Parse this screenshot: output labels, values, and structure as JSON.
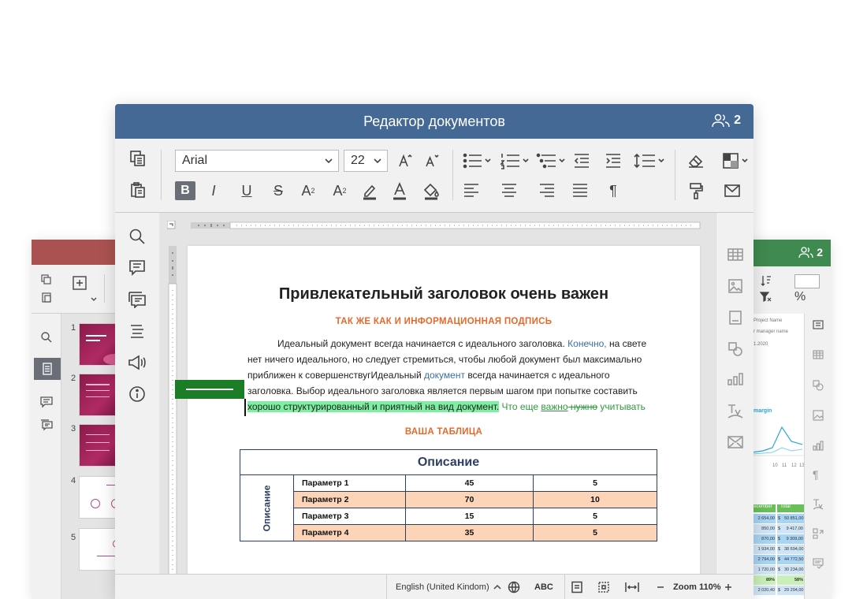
{
  "main_window": {
    "title": "Редактор документов",
    "users_count": "2",
    "toolbar": {
      "font_name": "Arial",
      "font_size": "22",
      "bold_label": "B",
      "italic_label": "I",
      "underline_label": "U",
      "strike_label": "S",
      "superscript_label": "A",
      "subscript_label": "A"
    },
    "document": {
      "title": "Привлекательный заголовок очень важен",
      "subtitle": "ТАК ЖЕ КАК И ИНФОРМАЦИОННАЯ ПОДПИСЬ",
      "body": {
        "l1a": "Идеальный документ всегда начинается с идеального заголовка. ",
        "l1b": "Конечно,",
        "l1c": " на свете",
        "l2": "нет ничего идеального, но следует стремиться, чтобы любой документ был максимально",
        "l3a": "приближен к совершенствуг",
        "l3b": "Идеальный ",
        "l3c": "документ",
        "l3d": " всегда начинается с идеального",
        "l4": "заголовка. Выбор идеального заголовка является первым шагом при попытке составить",
        "l5a": "хорошо структурированный и приятный на вид документ.",
        "l5b": " Что еще ",
        "l5c": "важно",
        "l5d": " нужно",
        "l5e": " учитывать"
      },
      "table_heading": "ВАША ТАБЛИЦА",
      "table": {
        "caption": "Описание",
        "row_header": "Описание",
        "rows": [
          {
            "name": "Параметр 1",
            "v1": "45",
            "v2": "5"
          },
          {
            "name": "Параметр 2",
            "v1": "70",
            "v2": "10"
          },
          {
            "name": "Параметр 3",
            "v1": "15",
            "v2": "5"
          },
          {
            "name": "Параметр 4",
            "v1": "35",
            "v2": "5"
          }
        ]
      }
    },
    "statusbar": {
      "language": "English (United Kindom)",
      "spell_label": "ABC",
      "zoom_label": "Zoom 110%"
    }
  },
  "left_window": {
    "slide_numbers": [
      "1",
      "2",
      "3",
      "4",
      "5"
    ]
  },
  "right_window": {
    "users_count": "2",
    "percent_label": "%",
    "cell_texts": {
      "project_name": "Project Name",
      "manager_name": "r manager name",
      "date": "1.2020",
      "margin": "margin",
      "axis": [
        "10",
        "11",
        "12",
        "13"
      ],
      "col_december": "December",
      "col_total": "Total",
      "rows": [
        [
          "$",
          "2 654,00",
          "$",
          "50 851,00"
        ],
        [
          "$",
          "850,00",
          "$",
          "9 417,00"
        ],
        [
          "$",
          "870,00",
          "$",
          "9 309,00"
        ],
        [
          "$",
          "1 934,00",
          "$",
          "38 694,00"
        ],
        [
          "$",
          "2 794,00",
          "$",
          "44 772,50"
        ],
        [
          "$",
          "1 720,00",
          "$",
          "30 234,00"
        ],
        [
          "",
          "89%",
          "",
          "58%"
        ],
        [
          "$",
          "2 020,40",
          "$",
          "29 294,00"
        ]
      ]
    }
  },
  "colors": {
    "main_title_bar": "#446995",
    "presentation_title_bar": "#aa5252",
    "spreadsheet_title_bar": "#3f8a50",
    "highlight": "#7cf0a0",
    "accent_orange": "#e4692a",
    "table_alt_row": "#fcd5b8"
  }
}
